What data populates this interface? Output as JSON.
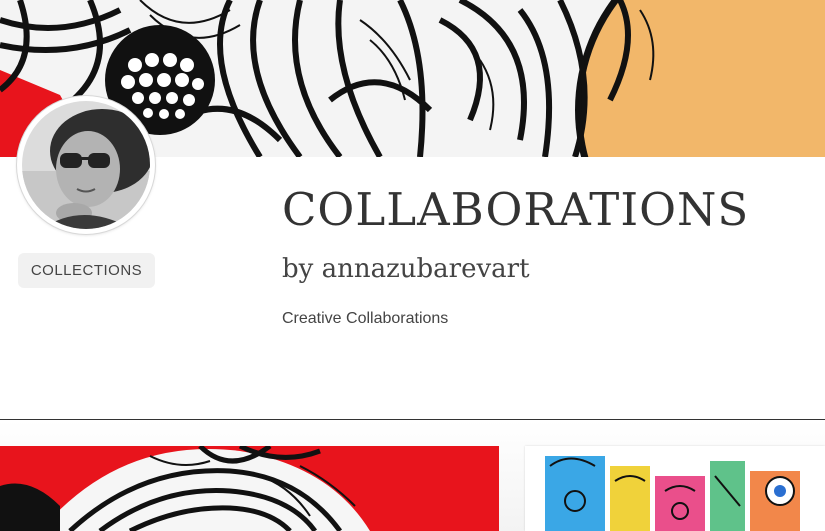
{
  "collection": {
    "title": "COLLABORATIONS",
    "byline": "by annazubarevart",
    "description": "Creative Collaborations"
  },
  "sidebar": {
    "collections_label": "COLLECTIONS"
  },
  "colors": {
    "banner_red": "#e8141c",
    "banner_peach": "#f2b76a",
    "button_bg": "#f1f1f1",
    "text_dark": "#333333"
  },
  "artworks": [
    {
      "icon": "artwork-thumbnail-red-floral"
    },
    {
      "icon": "artwork-thumbnail-colorful-collage"
    }
  ]
}
